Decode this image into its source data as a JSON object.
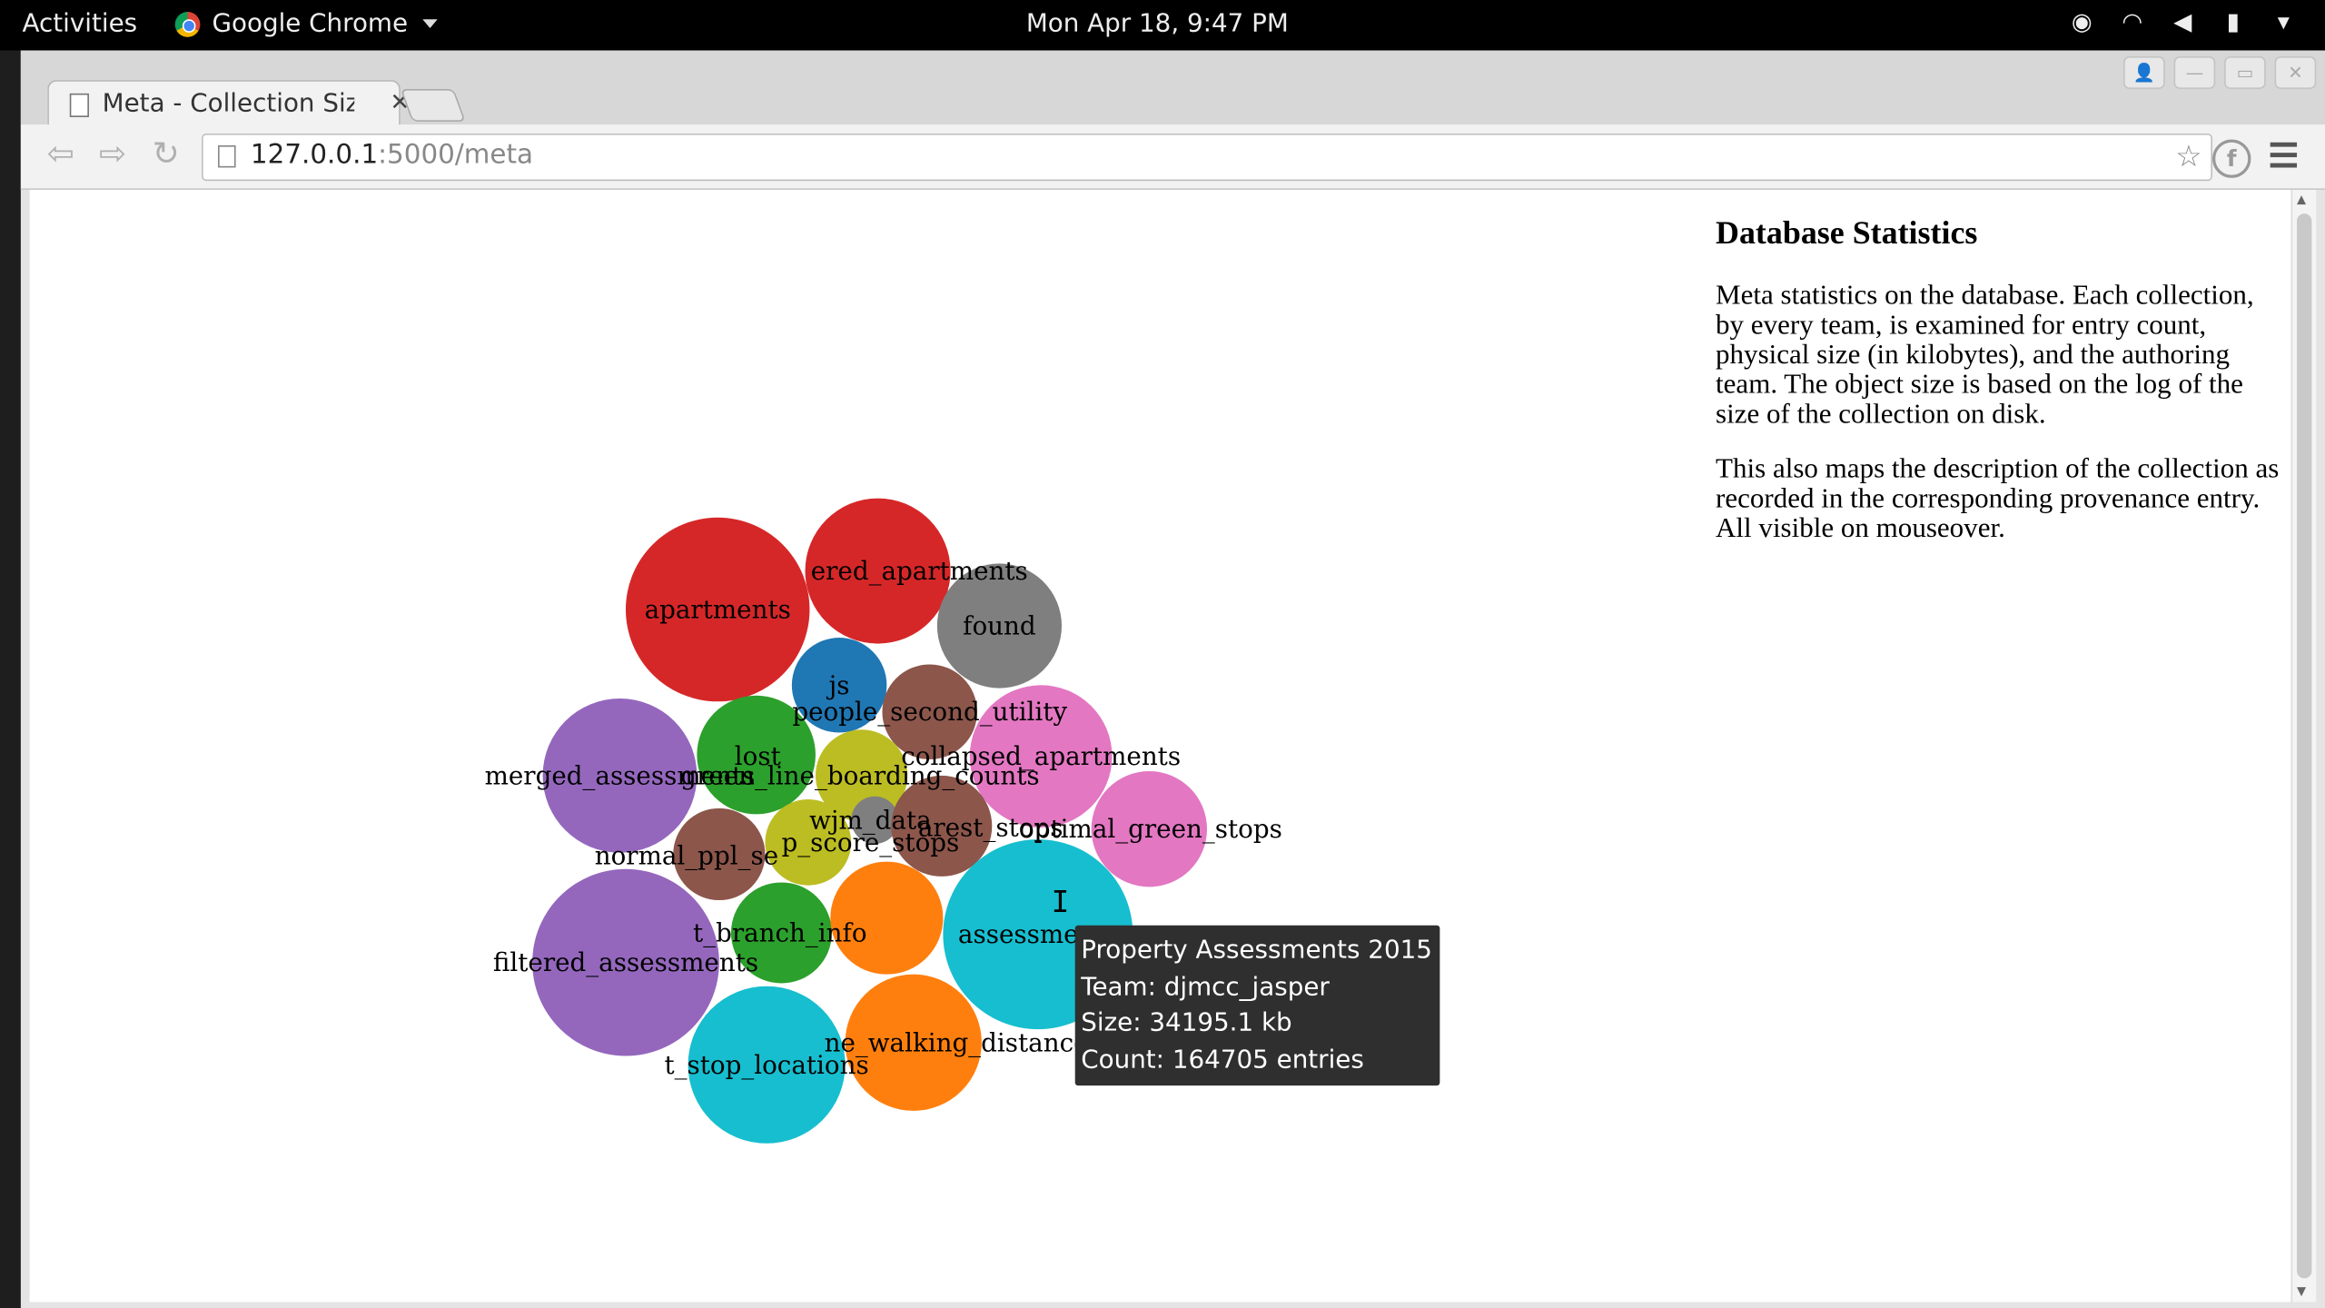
{
  "topbar": {
    "activities": "Activities",
    "app_name": "Google Chrome",
    "clock": "Mon Apr 18,  9:47 PM"
  },
  "browser": {
    "tab_title": "Meta - Collection Siz",
    "url_host": "127.0.0.1",
    "url_path": ":5000/meta"
  },
  "sidebar": {
    "heading": "Database Statistics",
    "paragraph1": "Meta statistics on the database. Each collection, by every team, is examined for entry count, physical size (in kilobytes), and the authoring team. The object size is based on the log of the size of the collection on disk.",
    "paragraph2": "This also maps the description of the collection as recorded in the corresponding provenance entry. All visible on mouseover."
  },
  "tooltip": {
    "description": "Property Assessments 2015",
    "team": "Team: djmcc_jasper",
    "size": "Size: 34195.1 kb",
    "count": "Count: 164705 entries"
  },
  "colors": {
    "red": "#d62728",
    "gray": "#7f7f7f",
    "blue": "#1f77b4",
    "brown": "#8c564b",
    "pink": "#e377c2",
    "green": "#2ca02c",
    "olive": "#bcbd22",
    "purple": "#9467bd",
    "orange": "#ff7f0e",
    "cyan": "#17becf"
  },
  "bubbles": [
    {
      "label": "apartments",
      "color": "red"
    },
    {
      "label": "ered_apartments",
      "color": "red"
    },
    {
      "label": "found",
      "color": "gray"
    },
    {
      "label": "js",
      "color": "blue"
    },
    {
      "label": "people_second_utility",
      "color": "brown"
    },
    {
      "label": "collapsed_apartments",
      "color": "pink"
    },
    {
      "label": "optimal_green_stops",
      "color": "pink"
    },
    {
      "label": "lost",
      "color": "green"
    },
    {
      "label": "green_line_boarding_counts",
      "color": "olive"
    },
    {
      "label": "merged_assessments",
      "color": "purple"
    },
    {
      "label": "wjm_data",
      "color": "gray"
    },
    {
      "label": "arest_stops",
      "color": "brown"
    },
    {
      "label": "p_score_stops",
      "color": "olive"
    },
    {
      "label": "normal_ppl_se",
      "color": "brown"
    },
    {
      "label": "t_branch_info",
      "color": "green"
    },
    {
      "label": "",
      "color": "orange"
    },
    {
      "label": "assessments",
      "color": "cyan"
    },
    {
      "label": "filtered_assessments",
      "color": "purple"
    },
    {
      "label": "ne_walking_distance",
      "color": "orange"
    },
    {
      "label": "t_stop_locations",
      "color": "cyan"
    }
  ]
}
